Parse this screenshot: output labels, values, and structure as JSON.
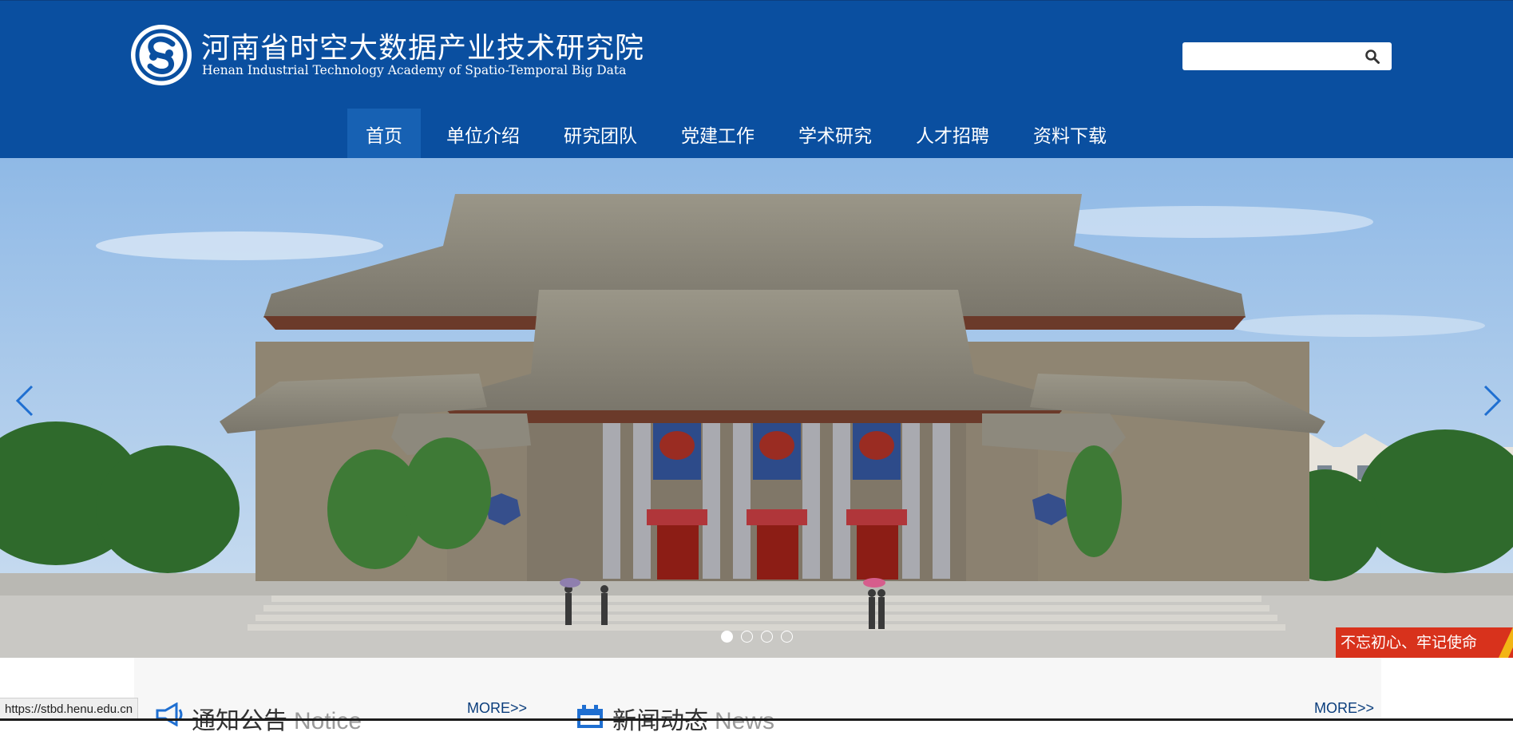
{
  "header": {
    "title_cn": "河南省时空大数据产业技术研究院",
    "title_en": "Henan Industrial Technology Academy of Spatio-Temporal Big Data",
    "search": {
      "value": "",
      "placeholder": ""
    }
  },
  "nav": {
    "items": [
      {
        "label": "首页",
        "active": true
      },
      {
        "label": "单位介绍"
      },
      {
        "label": "研究团队"
      },
      {
        "label": "党建工作"
      },
      {
        "label": "学术研究"
      },
      {
        "label": "人才招聘"
      },
      {
        "label": "资料下载"
      }
    ]
  },
  "banner": {
    "slide_count": 4,
    "active_slide": 1,
    "slogan": "不忘初心、牢记使命"
  },
  "sections": {
    "notice": {
      "title_cn": "通知公告",
      "title_en": "Notice",
      "more": "MORE>>"
    },
    "news": {
      "title_cn": "新闻动态",
      "title_en": "News",
      "more": "MORE>>"
    }
  },
  "status_bar": {
    "url": "https://stbd.henu.edu.cn"
  },
  "colors": {
    "header_bg": "#0a4fa0",
    "nav_active": "#1761b3",
    "slogan_bg": "#d8321c",
    "accent_link": "#0a3d7c"
  },
  "icons": [
    "logo-icon",
    "search-icon",
    "arrow-left-icon",
    "arrow-right-icon",
    "megaphone-icon",
    "calendar-icon"
  ]
}
